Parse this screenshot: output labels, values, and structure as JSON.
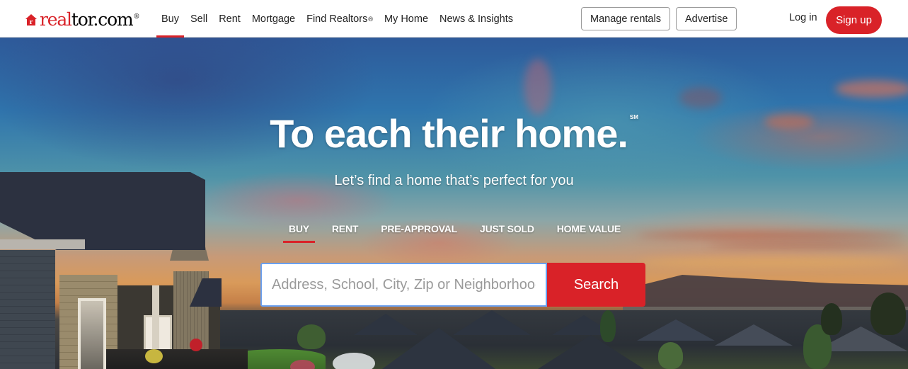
{
  "header": {
    "logo": {
      "part1": "real",
      "part2": "tor.com",
      "trademark": "®"
    },
    "nav": [
      {
        "label": "Buy",
        "active": true
      },
      {
        "label": "Sell"
      },
      {
        "label": "Rent"
      },
      {
        "label": "Mortgage"
      },
      {
        "label": "Find Realtors",
        "superscript": "®"
      },
      {
        "label": "My Home"
      },
      {
        "label": "News & Insights"
      }
    ],
    "manage_rentals_label": "Manage rentals",
    "advertise_label": "Advertise",
    "login_label": "Log in",
    "signup_label": "Sign up"
  },
  "hero": {
    "title": "To each their home.",
    "title_mark": "SM",
    "subtitle": "Let’s find a home that’s perfect for you",
    "tabs": [
      {
        "label": "BUY",
        "active": true
      },
      {
        "label": "RENT"
      },
      {
        "label": "PRE-APPROVAL"
      },
      {
        "label": "JUST SOLD"
      },
      {
        "label": "HOME VALUE"
      }
    ],
    "search": {
      "value": "",
      "placeholder": "Address, School, City, Zip or Neighborhood",
      "button_label": "Search"
    }
  },
  "colors": {
    "brand_red": "#d92228",
    "search_focus_border": "#6aa0f0"
  }
}
